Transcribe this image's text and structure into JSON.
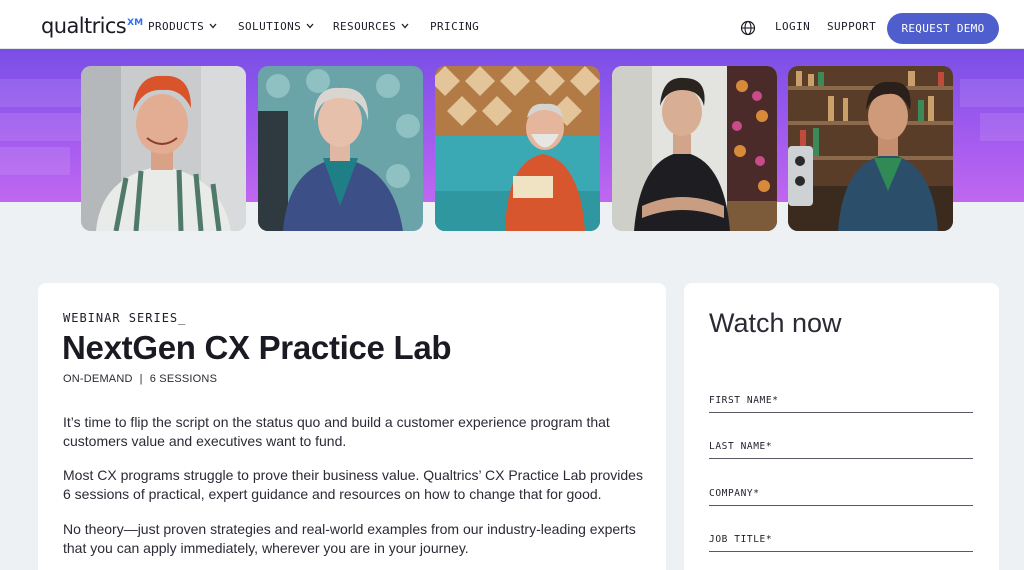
{
  "nav": {
    "logo_text": "qualtrics",
    "logo_mark": "XM",
    "items": [
      {
        "label": "PRODUCTS",
        "has_dropdown": true
      },
      {
        "label": "SOLUTIONS",
        "has_dropdown": true
      },
      {
        "label": "RESOURCES",
        "has_dropdown": true
      },
      {
        "label": "PRICING",
        "has_dropdown": false
      }
    ],
    "globe_icon": "globe-icon",
    "login": "LOGIN",
    "support": "SUPPORT",
    "request_demo": "REQUEST DEMO"
  },
  "hero": {
    "photos": [
      {
        "alt": "man-with-red-hair-smiling"
      },
      {
        "alt": "older-woman-seated"
      },
      {
        "alt": "older-man-reading-on-couch"
      },
      {
        "alt": "woman-with-tattoos-arms-crossed"
      },
      {
        "alt": "man-leaning-on-bar-counter"
      }
    ]
  },
  "content": {
    "eyebrow": "WEBINAR SERIES_",
    "title": "NextGen CX Practice Lab",
    "meta_left": "ON-DEMAND",
    "meta_sep": "|",
    "meta_right": "6 SESSIONS",
    "paragraphs": [
      "It’s time to flip the script on the status quo and build a customer experience program that customers value and executives want to fund.",
      "Most CX programs struggle to prove their business value. Qualtrics’ CX Practice Lab provides 6 sessions of practical, expert guidance and resources on how to change that for good.",
      "No theory—just proven strategies and real-world examples  from our industry-leading experts that you can apply immediately, wherever you are in your journey."
    ]
  },
  "form": {
    "heading": "Watch now",
    "fields": [
      {
        "label": "FIRST NAME*"
      },
      {
        "label": "LAST NAME*"
      },
      {
        "label": "COMPANY*"
      },
      {
        "label": "JOB TITLE*"
      }
    ]
  },
  "colors": {
    "accent": "#4e5fcd",
    "hero_top": "#7a4fe6",
    "hero_bottom": "#c067f0",
    "page_bg": "#eef1f4"
  }
}
